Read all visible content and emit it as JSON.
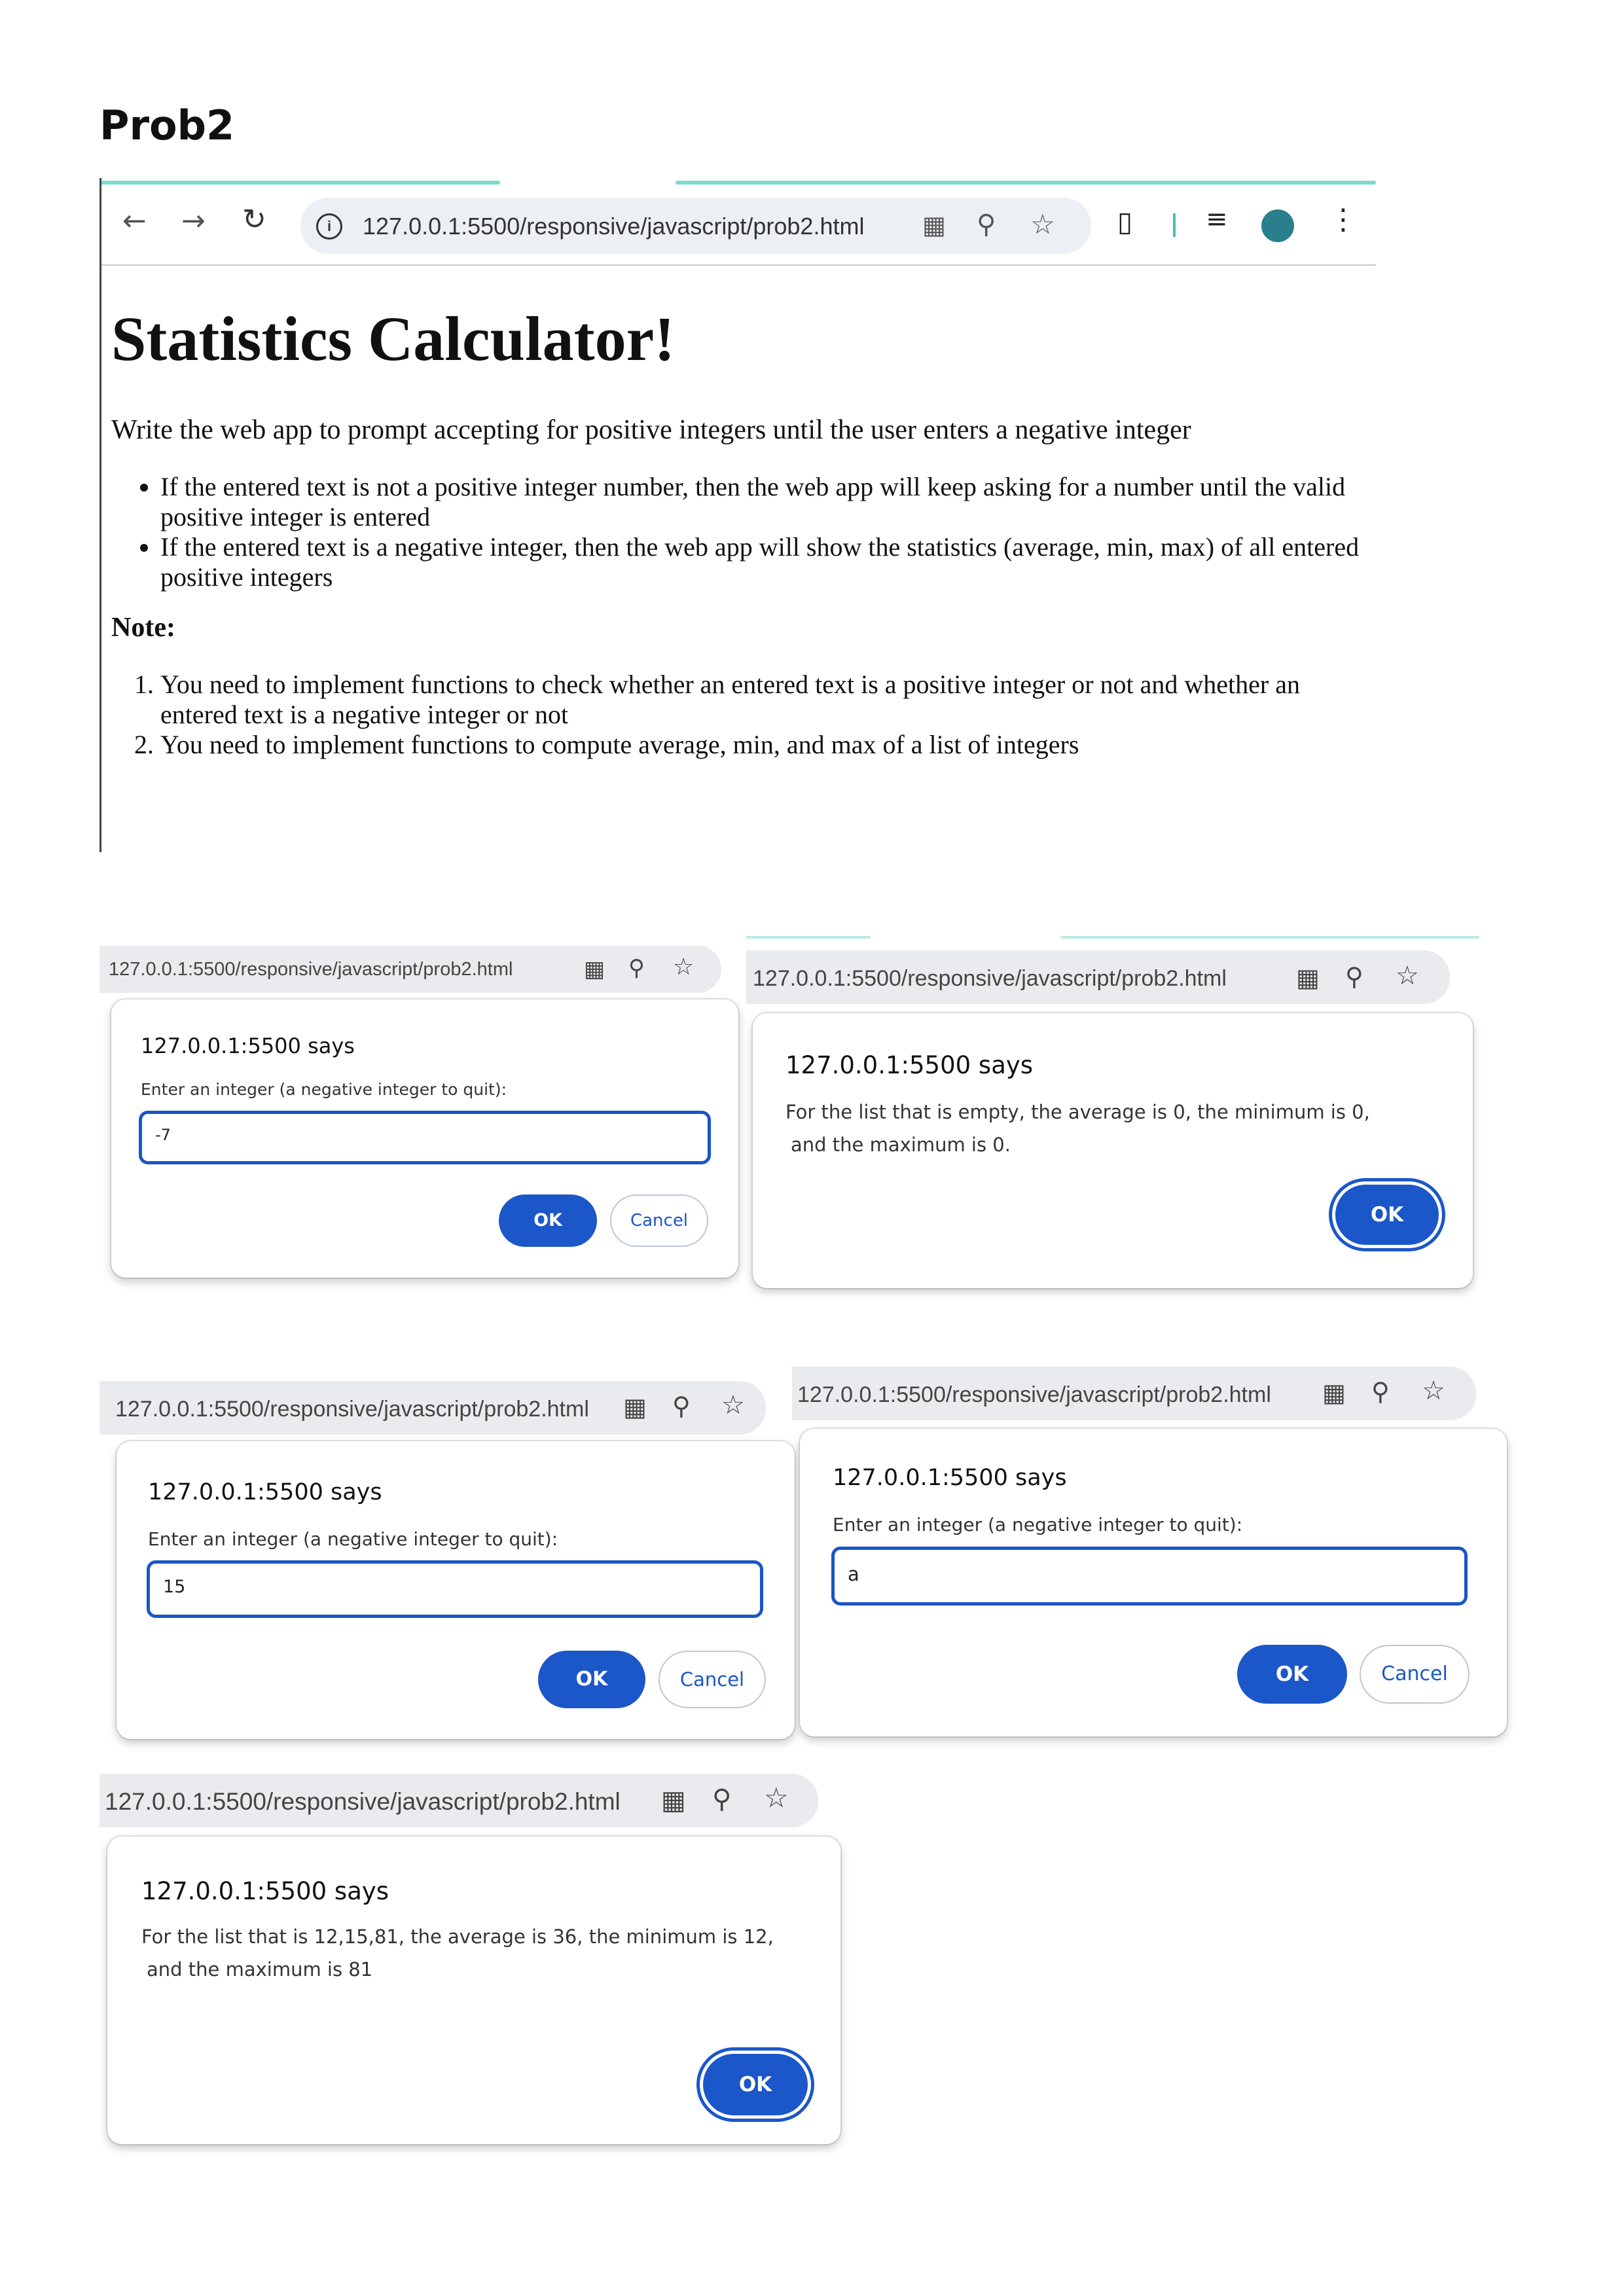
{
  "doc_title": "Prob2",
  "browser": {
    "url": "127.0.0.1:5500/responsive/javascript/prob2.html",
    "page": {
      "heading": "Statistics Calculator!",
      "intro": "Write the web app to prompt accepting for positive integers until the user enters a negative integer",
      "bullets": [
        "If the entered text is not a positive integer number, then the web app will keep asking for a number until the valid positive integer is entered",
        "If the entered text is a negative integer, then the web app will show the statistics (average, min, max) of all entered positive integers"
      ],
      "note_label": "Note:",
      "notes": [
        "You need to implement functions to check whether an entered text is a positive integer or not and whether an entered text is a negative integer or not",
        "You need to implement functions to compute average, min, and max of a list of integers"
      ]
    }
  },
  "dialogs": [
    {
      "url": "127.0.0.1:5500/responsive/javascript/prob2.html",
      "says": "127.0.0.1:5500 says",
      "prompt": "Enter an integer (a negative integer to quit):",
      "input_value": "-7",
      "ok": "OK",
      "cancel": "Cancel"
    },
    {
      "url": "127.0.0.1:5500/responsive/javascript/prob2.html",
      "says": "127.0.0.1:5500 says",
      "message_line1": "For the list that is empty, the average is 0, the minimum is 0,",
      "message_line2": "and the maximum is 0.",
      "ok": "OK"
    },
    {
      "url": "127.0.0.1:5500/responsive/javascript/prob2.html",
      "says": "127.0.0.1:5500 says",
      "prompt": "Enter an integer (a negative integer to quit):",
      "input_value": "15",
      "ok": "OK",
      "cancel": "Cancel"
    },
    {
      "url": "127.0.0.1:5500/responsive/javascript/prob2.html",
      "says": "127.0.0.1:5500 says",
      "prompt": "Enter an integer (a negative integer to quit):",
      "input_value": "a",
      "ok": "OK",
      "cancel": "Cancel"
    },
    {
      "url": "127.0.0.1:5500/responsive/javascript/prob2.html",
      "says": "127.0.0.1:5500 says",
      "message_line1": "For the list that is 12,15,81, the average is 36, the minimum is 12,",
      "message_line2": "and the maximum is 81",
      "ok": "OK"
    }
  ],
  "colors": {
    "accent": "#1b57c8",
    "tab_highlight": "#7fd9cf"
  }
}
